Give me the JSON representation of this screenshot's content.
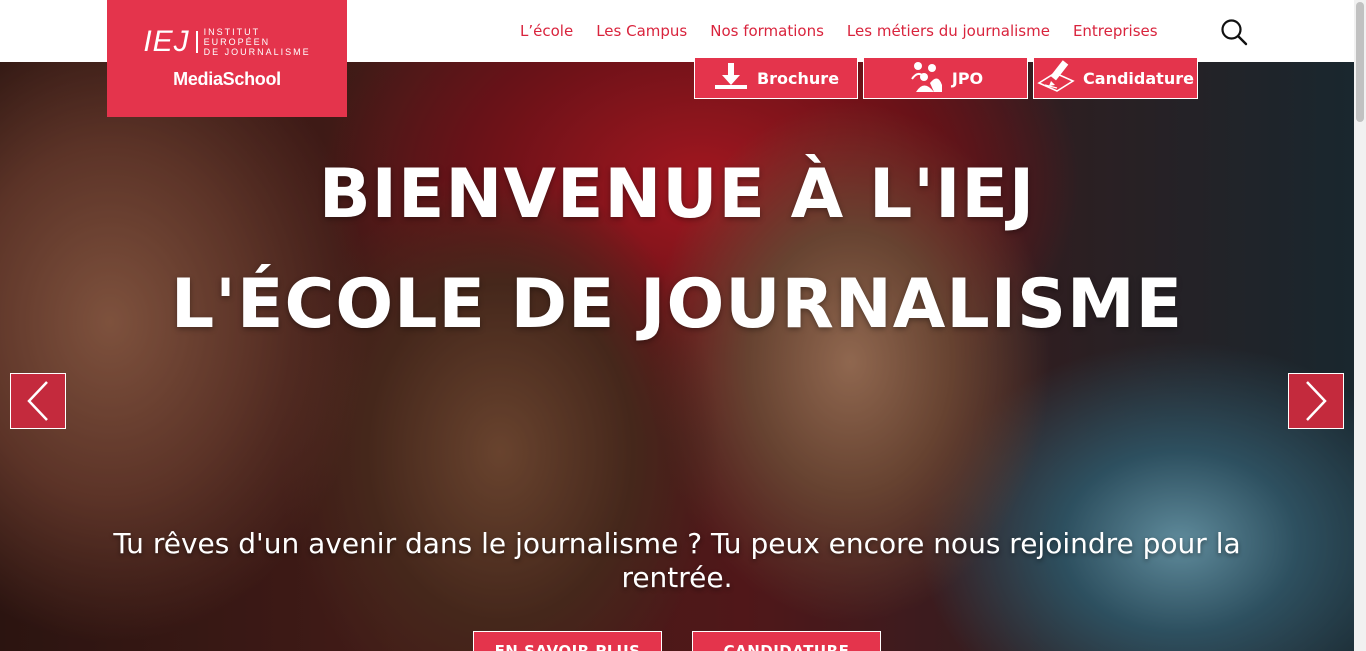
{
  "logo": {
    "mark": "IEJ",
    "lines": [
      "INSTITUT",
      "EUROPÉEN",
      "DE JOURNALISME"
    ],
    "brand": "MediaSchool"
  },
  "nav": {
    "items": [
      "L’école",
      "Les Campus",
      "Nos formations",
      "Les métiers du journalisme",
      "Entreprises"
    ]
  },
  "search_icon": "search-icon",
  "cta": {
    "brochure": "Brochure",
    "jpo": "JPO",
    "candidature": "Candidature"
  },
  "hero": {
    "title_line1": "BIENVENUE À L'IEJ",
    "title_line2": "L'ÉCOLE DE JOURNALISME",
    "subtitle": "Tu rêves d'un avenir dans le journalisme ? Tu peux encore nous rejoindre pour la rentrée.",
    "button1": "EN SAVOIR PLUS",
    "button2": "CANDIDATURE"
  },
  "colors": {
    "accent": "#e4344c",
    "nav_text": "#d9243d",
    "arrow_bg": "#c42a3d"
  }
}
